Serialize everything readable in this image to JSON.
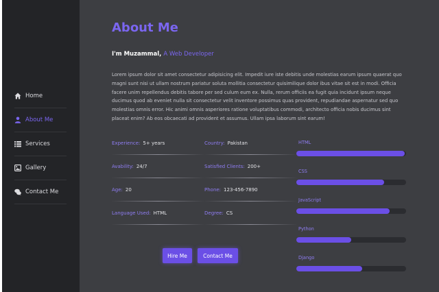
{
  "nav": [
    {
      "label": "Home",
      "icon": "home-icon"
    },
    {
      "label": "About Me",
      "icon": "user-icon"
    },
    {
      "label": "Services",
      "icon": "list-icon"
    },
    {
      "label": "Gallery",
      "icon": "image-icon"
    },
    {
      "label": "Contact Me",
      "icon": "chat-icon"
    }
  ],
  "active_nav": "About Me",
  "title": "About Me",
  "intro": {
    "name": "I'm Muzammal,",
    "role": "A Web Developer"
  },
  "bio": "Lorem ipsum dolor sit amet consectetur adipisicing elit. Impedit iure iste debitis unde molestias earum ipsum quaerat quo magni sunt nisi ut ullam nostrum pariatur soluta mollitia consectetur quisimilique dolor ibus vitae sit est in modi. Officia facere unim repellendus debitis tabore per sed culum eum ex. Nulla, rerum officiis ea fugit quia incidunt ipsum neque ducimus quod ab eveniet nulla sit consectetur velit inventore possimus quas provident, repudiandae aspernatur sed quo molestias omnis error. Hic animi omnis asperiores ratione voluptatibus commodi, architecto officia nobis ducimus sint placeat enim? Ab eos obcaecati ad provident et assumus. Ullam ipsa laborum sint earum!",
  "info": [
    [
      {
        "label": "Experience:",
        "value": "5+ years"
      },
      {
        "label": "Country:",
        "value": "Pakistan"
      }
    ],
    [
      {
        "label": "Avability:",
        "value": "24/7"
      },
      {
        "label": "Satisfied Clients:",
        "value": "200+"
      }
    ],
    [
      {
        "label": "Age:",
        "value": "20"
      },
      {
        "label": "Phone:",
        "value": "123-456-7890"
      }
    ],
    [
      {
        "label": "Language Used:",
        "value": "HTML"
      },
      {
        "label": "Degree:",
        "value": "CS"
      }
    ]
  ],
  "buttons": {
    "hire": "Hire Me",
    "contact": "Contact Me"
  },
  "skills": [
    {
      "name": "HTML",
      "level": 0.99
    },
    {
      "name": "CSS",
      "level": 0.8
    },
    {
      "name": "JavaScript",
      "level": 0.85
    },
    {
      "name": "Python",
      "level": 0.5
    },
    {
      "name": "Django",
      "level": 0.6
    }
  ],
  "colors": {
    "accent": "#7b66f0",
    "button": "#6b4fe6",
    "sidebar": "#232427",
    "background": "#3d3e42"
  }
}
